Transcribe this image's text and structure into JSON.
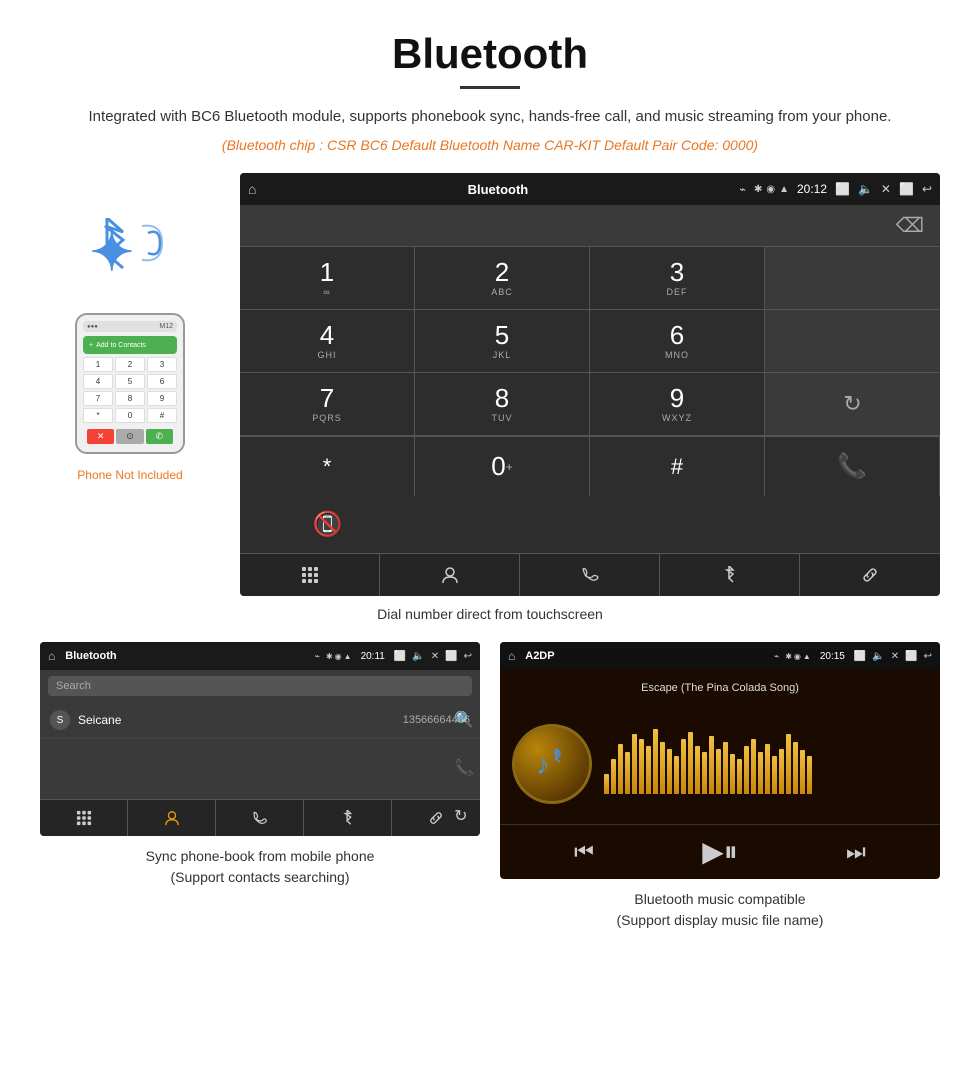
{
  "page": {
    "title": "Bluetooth",
    "description": "Integrated with BC6 Bluetooth module, supports phonebook sync, hands-free call, and music streaming from your phone.",
    "specs": "(Bluetooth chip : CSR BC6    Default Bluetooth Name CAR-KIT    Default Pair Code: 0000)"
  },
  "phone_label": "Phone Not Included",
  "dialer": {
    "title": "Bluetooth",
    "time": "20:12",
    "keys": [
      {
        "num": "1",
        "sub": ""
      },
      {
        "num": "2",
        "sub": "ABC"
      },
      {
        "num": "3",
        "sub": "DEF"
      },
      {
        "num": "",
        "sub": ""
      },
      {
        "num": "4",
        "sub": "GHI"
      },
      {
        "num": "5",
        "sub": "JKL"
      },
      {
        "num": "6",
        "sub": "MNO"
      },
      {
        "num": "",
        "sub": ""
      },
      {
        "num": "7",
        "sub": "PQRS"
      },
      {
        "num": "8",
        "sub": "TUV"
      },
      {
        "num": "9",
        "sub": "WXYZ"
      },
      {
        "num": "",
        "sub": ""
      }
    ],
    "bottom_keys": [
      {
        "label": "*"
      },
      {
        "label": "0+"
      },
      {
        "label": "#"
      },
      {
        "label": "📞"
      },
      {
        "label": "📵"
      }
    ],
    "toolbar": [
      "⠿",
      "👤",
      "📞",
      "✱",
      "🔗"
    ]
  },
  "dial_caption": "Dial number direct from touchscreen",
  "phonebook": {
    "title": "Bluetooth",
    "time": "20:11",
    "search_placeholder": "Search",
    "contact_letter": "S",
    "contact_name": "Seicane",
    "contact_number": "13566664466",
    "toolbar": [
      "⠿",
      "👤",
      "📞",
      "✱",
      "🔗"
    ]
  },
  "phonebook_caption": "Sync phone-book from mobile phone\n(Support contacts searching)",
  "music": {
    "title": "A2DP",
    "time": "20:15",
    "song_title": "Escape (The Pina Colada Song)",
    "toolbar": [
      "⏮",
      "▶⏸",
      "⏭"
    ]
  },
  "music_caption": "Bluetooth music compatible\n(Support display music file name)",
  "eq_bars": [
    20,
    35,
    50,
    42,
    60,
    55,
    48,
    65,
    52,
    45,
    38,
    55,
    62,
    48,
    42,
    58,
    45,
    52,
    40,
    35,
    48,
    55,
    42,
    50,
    38,
    45,
    60,
    52,
    44,
    38
  ]
}
